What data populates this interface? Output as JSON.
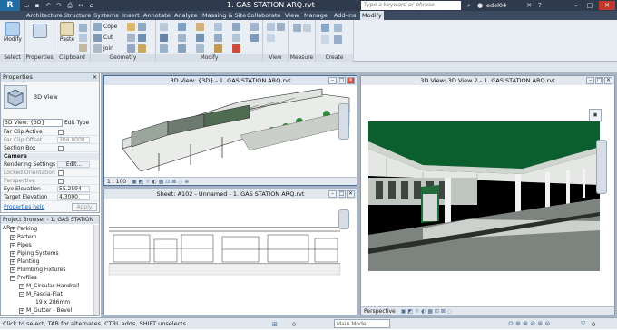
{
  "app": {
    "logo": "R",
    "title": "1. GAS STATION ARQ.rvt",
    "search_placeholder": "Type a keyword or phrase",
    "user": "edel04"
  },
  "tabs": [
    "Architecture",
    "Structure",
    "Systems",
    "Insert",
    "Annotate",
    "Analyze",
    "Massing & Site",
    "Collaborate",
    "View",
    "Manage",
    "Add-Ins",
    "Modify"
  ],
  "ribbon": {
    "select_label": "Select",
    "modify_label": "Modify",
    "properties_label": "Properties",
    "clipboard_label": "Clipboard",
    "paste_label": "Paste",
    "geometry_label": "Geometry",
    "cope_label": "Cope",
    "cut_label": "Cut",
    "join_label": "Join",
    "modify_group_label": "Modify",
    "view_label": "View",
    "measure_label": "Measure",
    "create_label": "Create"
  },
  "properties": {
    "header": "Properties",
    "type_name": "3D View",
    "selector": "3D View: {3D}",
    "edit_type": "Edit Type",
    "rows": [
      {
        "k": "Far Clip Active",
        "v": "",
        "type": "check"
      },
      {
        "k": "Far Clip Offset",
        "v": "304.8000",
        "type": "val"
      },
      {
        "k": "Section Box",
        "v": "",
        "type": "check"
      },
      {
        "k": "Camera",
        "v": "",
        "type": "section"
      },
      {
        "k": "Rendering Settings",
        "v": "Edit...",
        "type": "val"
      },
      {
        "k": "Locked Orientation",
        "v": "",
        "type": "check"
      },
      {
        "k": "Perspective",
        "v": "",
        "type": "check"
      },
      {
        "k": "Eye Elevation",
        "v": "55.2594",
        "type": "val"
      },
      {
        "k": "Target Elevation",
        "v": "4.3000",
        "type": "val"
      }
    ],
    "help": "Properties help",
    "apply": "Apply"
  },
  "browser": {
    "header": "Project Browser - 1. GAS STATION AR...",
    "items": [
      {
        "label": "Parking",
        "level": 1
      },
      {
        "label": "Pattern",
        "level": 1
      },
      {
        "label": "Pipes",
        "level": 1
      },
      {
        "label": "Piping Systems",
        "level": 1
      },
      {
        "label": "Planting",
        "level": 1
      },
      {
        "label": "Plumbing Fixtures",
        "level": 1
      },
      {
        "label": "Profiles",
        "level": 1,
        "open": true
      },
      {
        "label": "M_Circular Handrail",
        "level": 2
      },
      {
        "label": "M_Fascia-Flat",
        "level": 2,
        "open": true
      },
      {
        "label": "19 x 286mm",
        "level": 3
      },
      {
        "label": "M_Gutter - Bevel",
        "level": 2
      }
    ]
  },
  "views": {
    "v1_title": "3D View: {3D} - 1. GAS STATION ARQ.rvt",
    "v1_scale": "1 : 100",
    "v2_title": "3D View: 3D View 2 - 1. GAS STATION ARQ.rvt",
    "v2_mode": "Perspective",
    "v3_title": "Sheet: A102 - Unnamed - 1. GAS STATION ARQ.rvt"
  },
  "status": {
    "text": "Click to select, TAB for alternates, CTRL adds, SHIFT unselects.",
    "model": "Main Model",
    "filter_count": "0"
  },
  "colors": {
    "canopy_green": "#0b5e2e",
    "title_bar": "#2f3a4c",
    "accent": "#1f6ea6"
  }
}
